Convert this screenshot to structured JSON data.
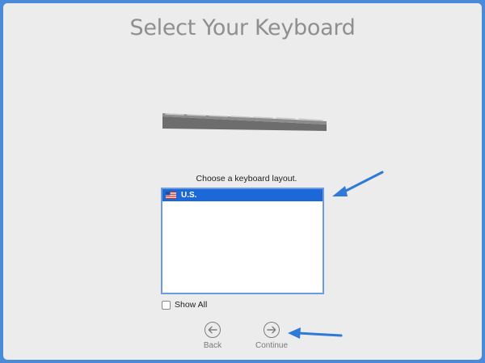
{
  "screen": {
    "title": "Select Your Keyboard",
    "prompt": "Choose a keyboard layout.",
    "layouts": [
      {
        "label": "U.S.",
        "flag": "us-flag-icon",
        "selected": true
      }
    ],
    "show_all": {
      "label": "Show All",
      "checked": false
    },
    "back_label": "Back",
    "continue_label": "Continue"
  },
  "colors": {
    "frame": "#4a8ad7",
    "selection": "#1b68d6",
    "annotation_arrow": "#2f7ad8"
  }
}
